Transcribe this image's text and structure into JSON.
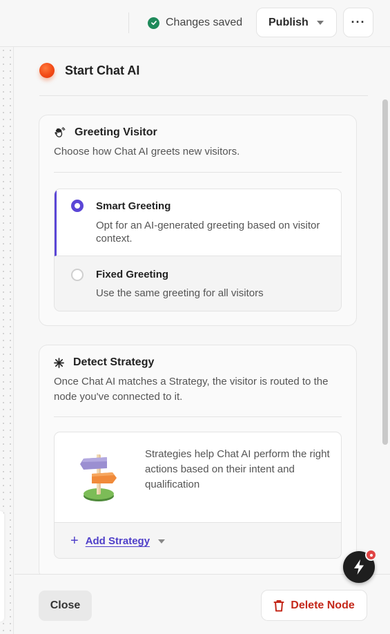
{
  "topbar": {
    "status_text": "Changes saved",
    "publish_label": "Publish",
    "more_label": "···"
  },
  "node": {
    "title": "Start Chat AI"
  },
  "greeting": {
    "title": "Greeting Visitor",
    "description": "Choose how Chat AI greets new visitors.",
    "options": [
      {
        "title": "Smart Greeting",
        "description": "Opt for an AI-generated greeting based on visitor context.",
        "selected": true
      },
      {
        "title": "Fixed Greeting",
        "description": "Use the same greeting for all visitors",
        "selected": false
      }
    ]
  },
  "strategy": {
    "title": "Detect Strategy",
    "description": "Once Chat AI matches a Strategy, the visitor is routed to the node you've connected to it.",
    "help_text": "Strategies help Chat AI perform the right actions based on their intent and qualification",
    "add_label": "Add Strategy"
  },
  "footer": {
    "close_label": "Close",
    "delete_label": "Delete Node"
  },
  "colors": {
    "accent": "#5b46d6",
    "danger": "#c4281a",
    "success": "#1f8a5b"
  }
}
